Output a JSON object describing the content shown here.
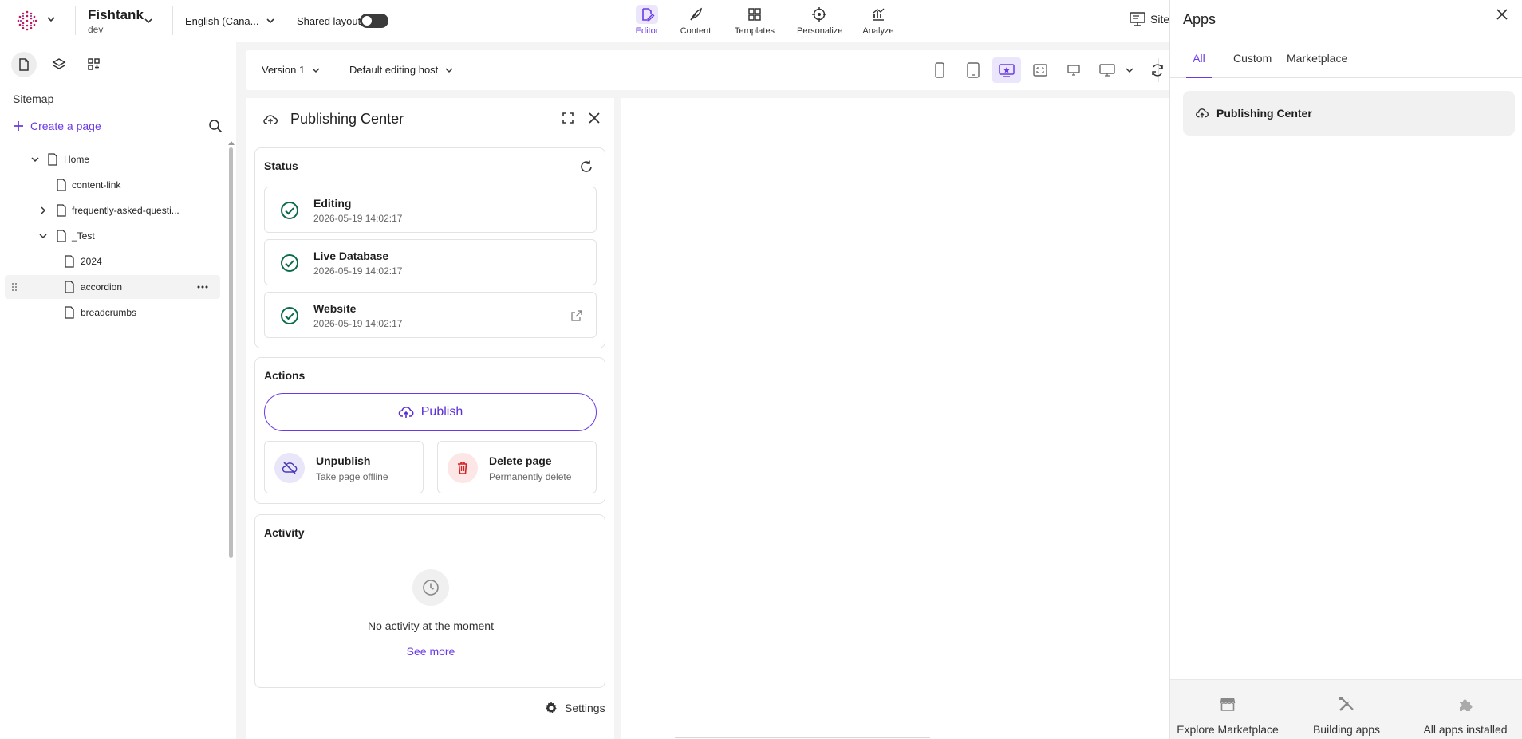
{
  "topbar": {
    "site_name": "Fishtank",
    "site_env": "dev",
    "language": "English (Cana...",
    "shared_layout_label": "Shared layout",
    "nav_tabs": [
      {
        "label": "Editor",
        "icon": "editor-icon"
      },
      {
        "label": "Content",
        "icon": "feather-icon"
      },
      {
        "label": "Templates",
        "icon": "templates-icon"
      },
      {
        "label": "Personalize",
        "icon": "target-icon"
      },
      {
        "label": "Analyze",
        "icon": "analyze-icon"
      }
    ],
    "site_button": "Site",
    "accent_color": "#6a3be4"
  },
  "sidebar": {
    "title": "Sitemap",
    "create_page": "Create a page",
    "tree": [
      {
        "label": "Home"
      },
      {
        "label": "content-link"
      },
      {
        "label": "frequently-asked-questi..."
      },
      {
        "label": "_Test"
      },
      {
        "label": "2024"
      },
      {
        "label": "accordion"
      },
      {
        "label": "breadcrumbs"
      }
    ]
  },
  "canvas": {
    "version": "Version 1",
    "editing_host": "Default editing host"
  },
  "publishing_center": {
    "title": "Publishing Center",
    "status": {
      "title": "Status",
      "items": [
        {
          "label": "Editing",
          "time": "2026-05-19 14:02:17"
        },
        {
          "label": "Live Database",
          "time": "2026-05-19 14:02:17"
        },
        {
          "label": "Website",
          "time": "2026-05-19 14:02:17"
        }
      ]
    },
    "actions": {
      "title": "Actions",
      "publish": "Publish",
      "unpublish": {
        "label": "Unpublish",
        "sub": "Take page offline"
      },
      "delete": {
        "label": "Delete page",
        "sub": "Permanently delete"
      }
    },
    "activity": {
      "title": "Activity",
      "empty": "No activity at the moment",
      "see_more": "See more"
    },
    "settings": "Settings"
  },
  "apps": {
    "title": "Apps",
    "tabs": [
      {
        "label": "All"
      },
      {
        "label": "Custom"
      },
      {
        "label": "Marketplace"
      }
    ],
    "items": [
      {
        "label": "Publishing Center"
      }
    ],
    "footer": [
      {
        "label": "Explore Marketplace",
        "icon": "store-icon"
      },
      {
        "label": "Building apps",
        "icon": "tools-icon"
      },
      {
        "label": "All apps installed",
        "icon": "puzzle-icon"
      }
    ]
  }
}
